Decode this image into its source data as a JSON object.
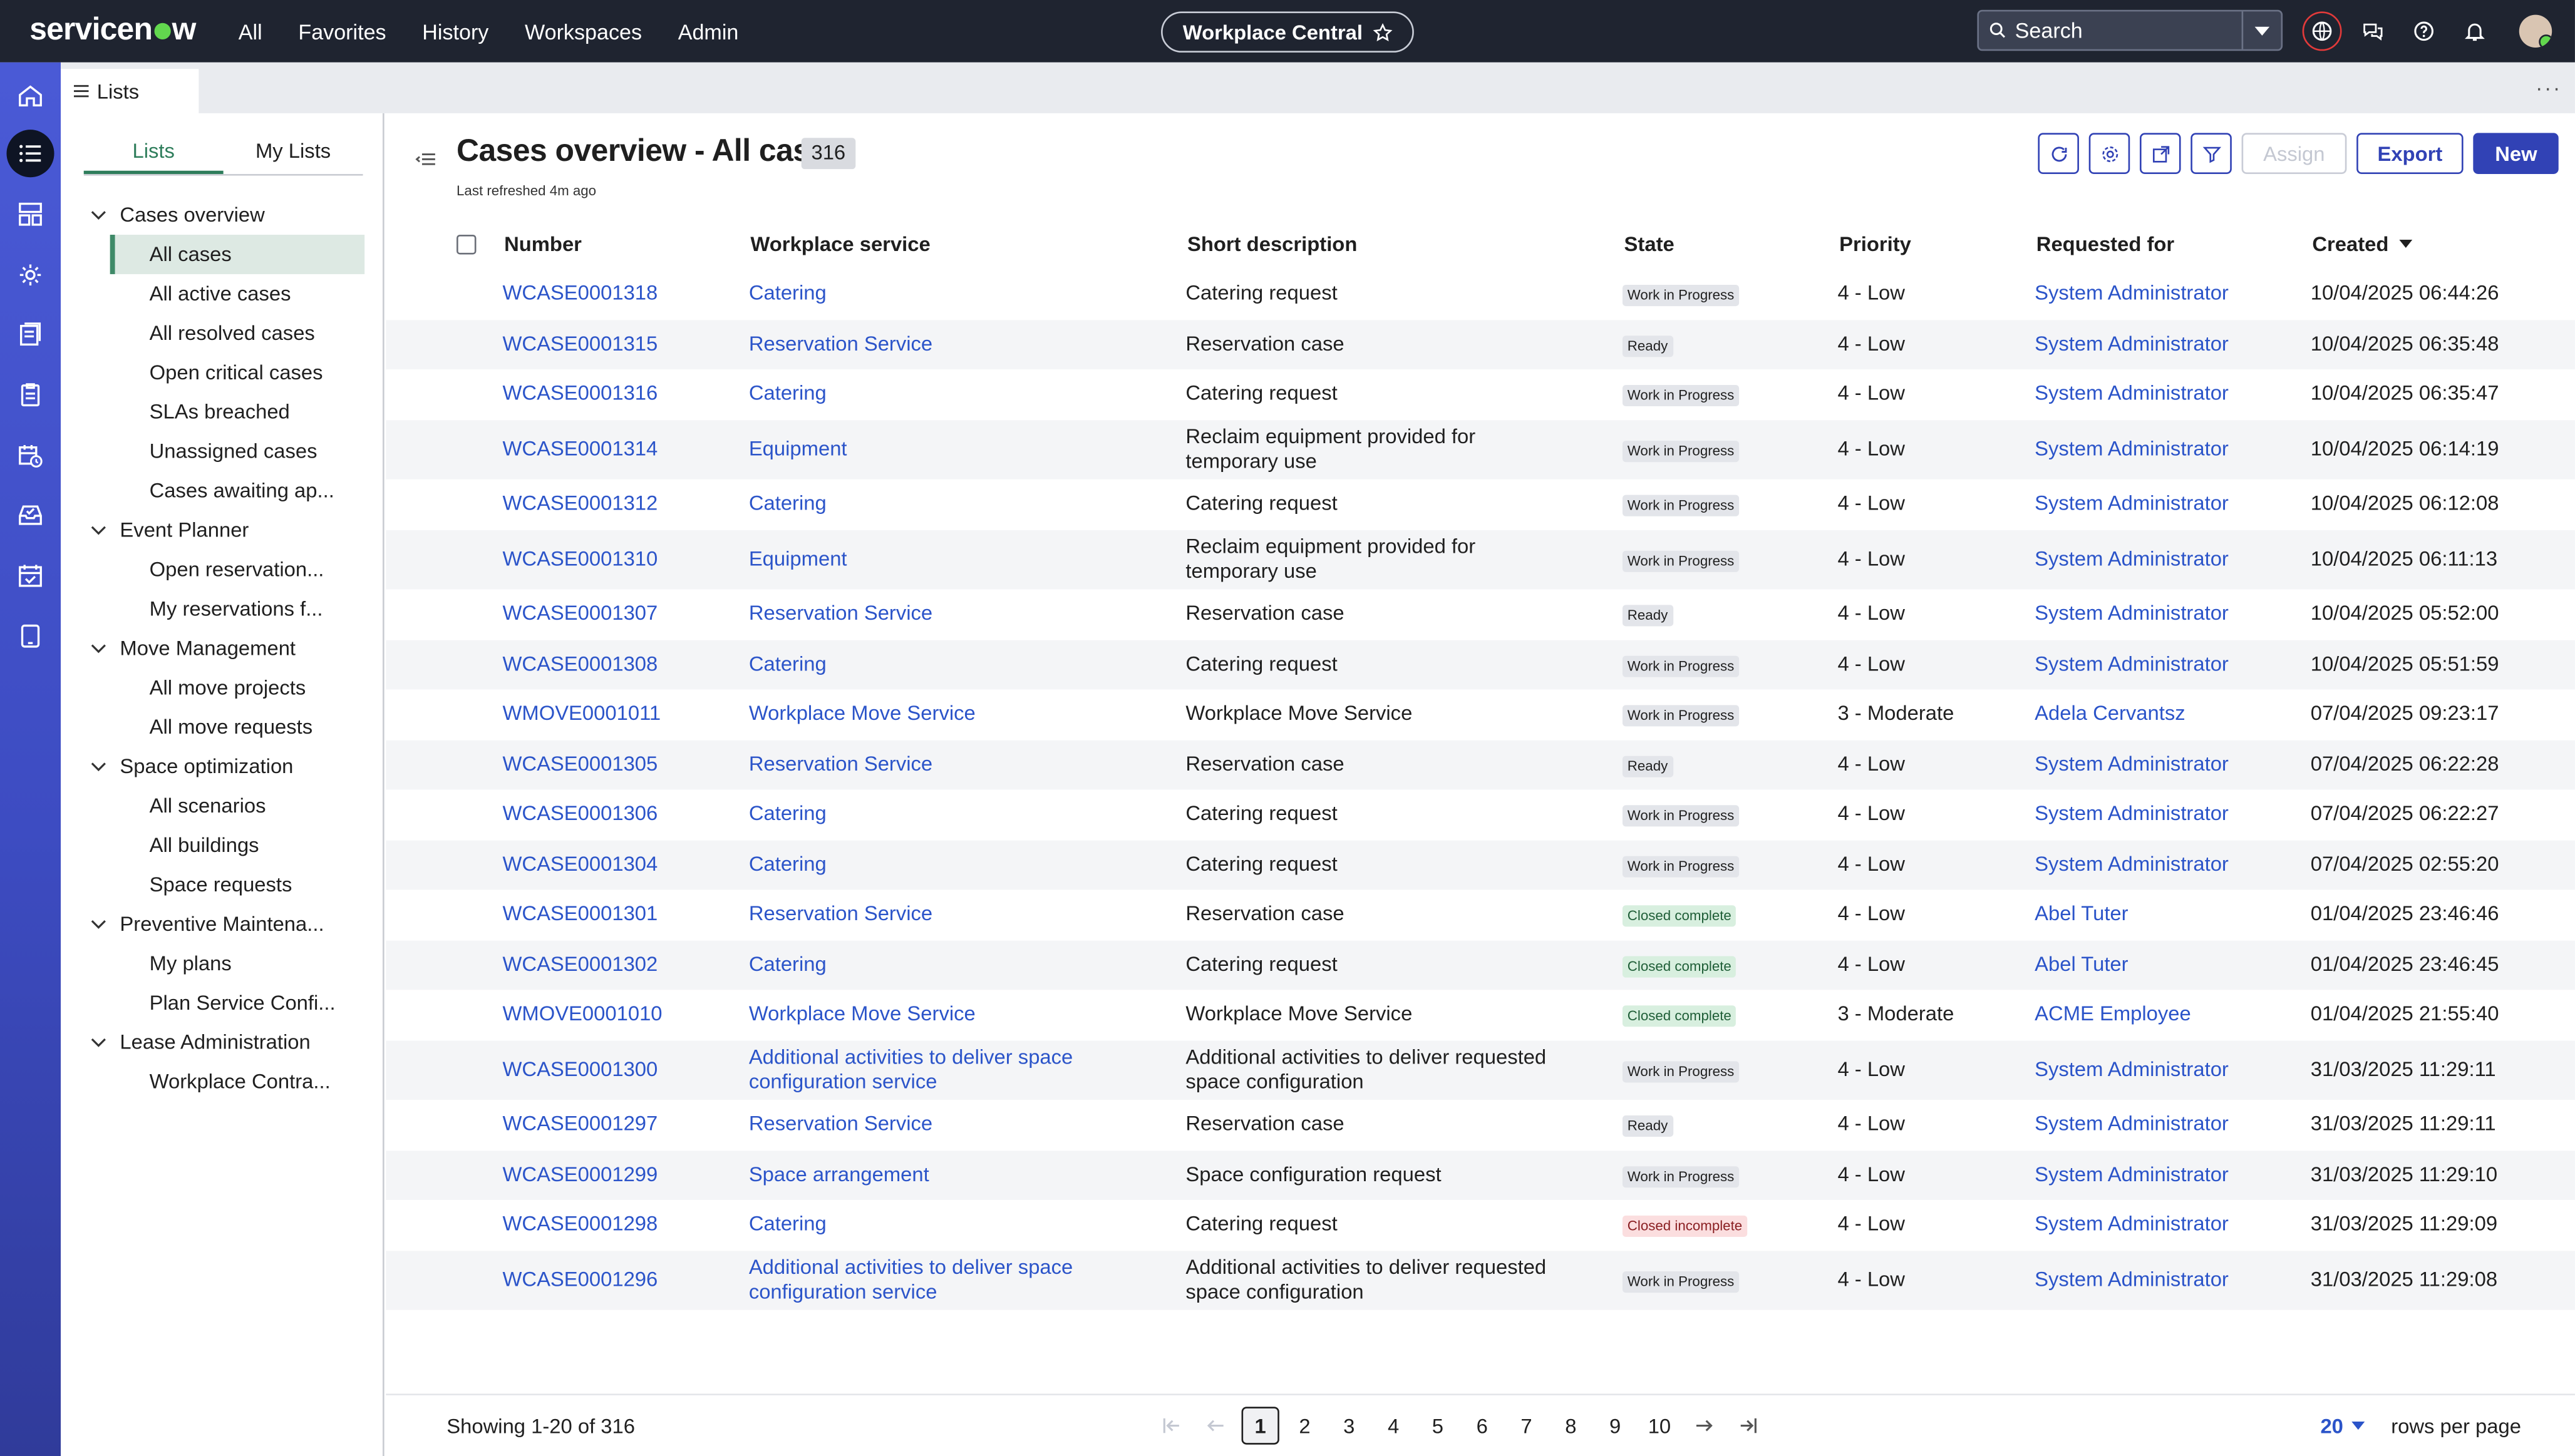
{
  "topbar": {
    "logo_left": "servicen",
    "logo_right": "w",
    "nav": [
      "All",
      "Favorites",
      "History",
      "Workspaces",
      "Admin"
    ],
    "workspace": "Workplace Central",
    "search_placeholder": "Search"
  },
  "tabstrip": {
    "tab_label": "Lists",
    "more": "···"
  },
  "sidepanel": {
    "tabs": [
      "Lists",
      "My Lists"
    ],
    "groups": [
      {
        "label": "Cases overview",
        "items": [
          "All cases",
          "All active cases",
          "All resolved cases",
          "Open critical cases",
          "SLAs breached",
          "Unassigned cases",
          "Cases awaiting ap..."
        ]
      },
      {
        "label": "Event Planner",
        "items": [
          "Open reservation...",
          "My reservations f..."
        ]
      },
      {
        "label": "Move Management",
        "items": [
          "All move projects",
          "All move requests"
        ]
      },
      {
        "label": "Space optimization",
        "items": [
          "All scenarios",
          "All buildings",
          "Space requests"
        ]
      },
      {
        "label": "Preventive Maintena...",
        "items": [
          "My plans",
          "Plan Service Confi..."
        ]
      },
      {
        "label": "Lease Administration",
        "items": [
          "Workplace Contra..."
        ]
      }
    ]
  },
  "main": {
    "title": "Cases overview - All cases",
    "count": "316",
    "refreshed": "Last refreshed 4m ago",
    "buttons": {
      "assign": "Assign",
      "export": "Export",
      "new": "New"
    }
  },
  "table": {
    "headers": [
      "Number",
      "Workplace service",
      "Short description",
      "State",
      "Priority",
      "Requested for",
      "Created"
    ],
    "rows": [
      [
        "WCASE0001318",
        "Catering",
        "Catering request",
        "Work in Progress",
        "4 - Low",
        "System Administrator",
        "10/04/2025 06:44:26"
      ],
      [
        "WCASE0001315",
        "Reservation Service",
        "Reservation case",
        "Ready",
        "4 - Low",
        "System Administrator",
        "10/04/2025 06:35:48"
      ],
      [
        "WCASE0001316",
        "Catering",
        "Catering request",
        "Work in Progress",
        "4 - Low",
        "System Administrator",
        "10/04/2025 06:35:47"
      ],
      [
        "WCASE0001314",
        "Equipment",
        "Reclaim equipment provided for temporary use",
        "Work in Progress",
        "4 - Low",
        "System Administrator",
        "10/04/2025 06:14:19"
      ],
      [
        "WCASE0001312",
        "Catering",
        "Catering request",
        "Work in Progress",
        "4 - Low",
        "System Administrator",
        "10/04/2025 06:12:08"
      ],
      [
        "WCASE0001310",
        "Equipment",
        "Reclaim equipment provided for temporary use",
        "Work in Progress",
        "4 - Low",
        "System Administrator",
        "10/04/2025 06:11:13"
      ],
      [
        "WCASE0001307",
        "Reservation Service",
        "Reservation case",
        "Ready",
        "4 - Low",
        "System Administrator",
        "10/04/2025 05:52:00"
      ],
      [
        "WCASE0001308",
        "Catering",
        "Catering request",
        "Work in Progress",
        "4 - Low",
        "System Administrator",
        "10/04/2025 05:51:59"
      ],
      [
        "WMOVE0001011",
        "Workplace Move Service",
        "Workplace Move Service",
        "Work in Progress",
        "3 - Moderate",
        "Adela Cervantsz",
        "07/04/2025 09:23:17"
      ],
      [
        "WCASE0001305",
        "Reservation Service",
        "Reservation case",
        "Ready",
        "4 - Low",
        "System Administrator",
        "07/04/2025 06:22:28"
      ],
      [
        "WCASE0001306",
        "Catering",
        "Catering request",
        "Work in Progress",
        "4 - Low",
        "System Administrator",
        "07/04/2025 06:22:27"
      ],
      [
        "WCASE0001304",
        "Catering",
        "Catering request",
        "Work in Progress",
        "4 - Low",
        "System Administrator",
        "07/04/2025 02:55:20"
      ],
      [
        "WCASE0001301",
        "Reservation Service",
        "Reservation case",
        "Closed complete",
        "4 - Low",
        "Abel Tuter",
        "01/04/2025 23:46:46"
      ],
      [
        "WCASE0001302",
        "Catering",
        "Catering request",
        "Closed complete",
        "4 - Low",
        "Abel Tuter",
        "01/04/2025 23:46:45"
      ],
      [
        "WMOVE0001010",
        "Workplace Move Service",
        "Workplace Move Service",
        "Closed complete",
        "3 - Moderate",
        "ACME Employee",
        "01/04/2025 21:55:40"
      ],
      [
        "WCASE0001300",
        "Additional activities to deliver space configuration service",
        "Additional activities to deliver requested space configuration",
        "Work in Progress",
        "4 - Low",
        "System Administrator",
        "31/03/2025 11:29:11"
      ],
      [
        "WCASE0001297",
        "Reservation Service",
        "Reservation case",
        "Ready",
        "4 - Low",
        "System Administrator",
        "31/03/2025 11:29:11"
      ],
      [
        "WCASE0001299",
        "Space arrangement",
        "Space configuration request",
        "Work in Progress",
        "4 - Low",
        "System Administrator",
        "31/03/2025 11:29:10"
      ],
      [
        "WCASE0001298",
        "Catering",
        "Catering request",
        "Closed incomplete",
        "4 - Low",
        "System Administrator",
        "31/03/2025 11:29:09"
      ],
      [
        "WCASE0001296",
        "Additional activities to deliver space configuration service",
        "Additional activities to deliver requested space configuration",
        "Work in Progress",
        "4 - Low",
        "System Administrator",
        "31/03/2025 11:29:08"
      ]
    ]
  },
  "footer": {
    "showing": "Showing 1-20 of 316",
    "pages": [
      "1",
      "2",
      "3",
      "4",
      "5",
      "6",
      "7",
      "8",
      "9",
      "10"
    ],
    "current_page": "1",
    "rows_per_page_value": "20",
    "rows_per_page_label": "rows per page"
  },
  "colors": {
    "topbar_bg": "#1f2430",
    "rail_gradient": "#4a5ad6",
    "link": "#2b54c9",
    "primary_button": "#3142b5",
    "brand_green": "#62d84e"
  },
  "icons": [
    "home-icon",
    "list-icon",
    "dashboard-icon",
    "settings-cog-icon",
    "documents-icon",
    "clipboard-icon",
    "calendar-clock-icon",
    "inbox-check-icon",
    "calendar-check-icon",
    "tablet-icon"
  ]
}
